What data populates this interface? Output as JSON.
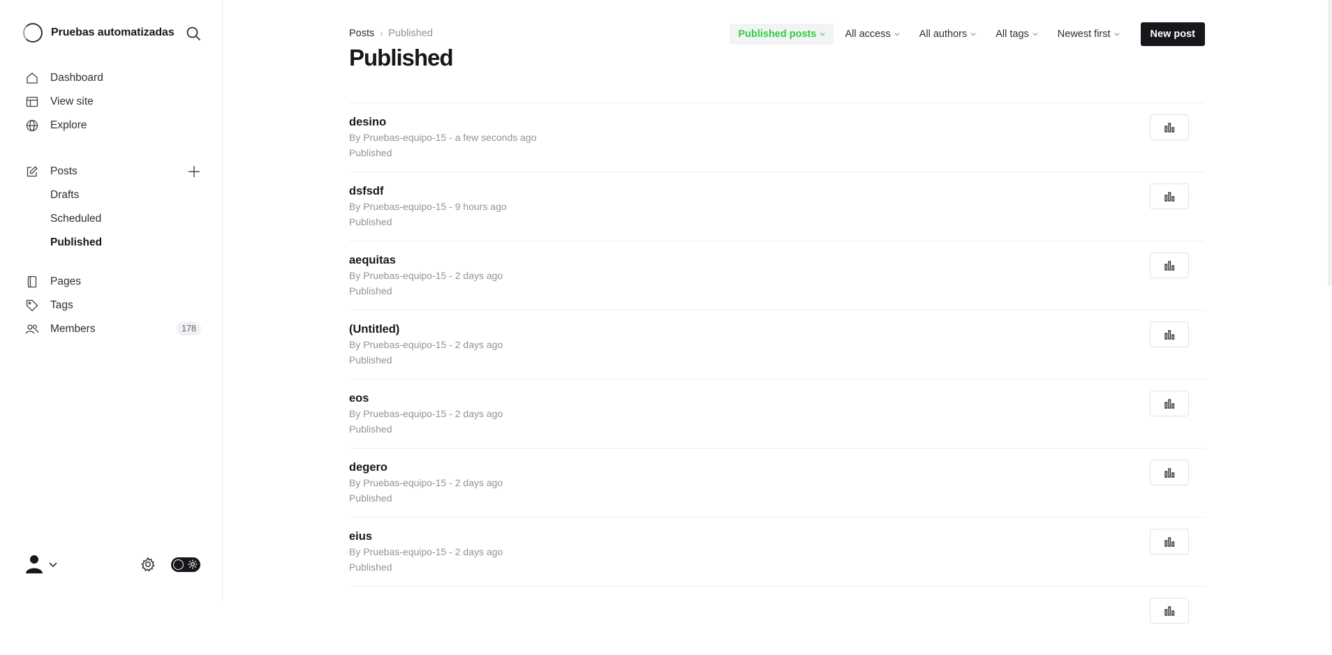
{
  "sidebar": {
    "site_name": "Pruebas automatizadas",
    "nav_primary": [
      {
        "label": "Dashboard",
        "icon": "home-icon"
      },
      {
        "label": "View site",
        "icon": "layout-icon"
      },
      {
        "label": "Explore",
        "icon": "globe-icon"
      }
    ],
    "posts": {
      "label": "Posts",
      "icon": "edit-icon"
    },
    "posts_sub": [
      {
        "label": "Drafts",
        "active": false
      },
      {
        "label": "Scheduled",
        "active": false
      },
      {
        "label": "Published",
        "active": true
      }
    ],
    "nav_secondary": [
      {
        "label": "Pages",
        "icon": "page-icon"
      },
      {
        "label": "Tags",
        "icon": "tag-icon"
      },
      {
        "label": "Members",
        "icon": "members-icon",
        "count": "178"
      }
    ]
  },
  "header": {
    "breadcrumb_parent": "Posts",
    "breadcrumb_current": "Published",
    "title": "Published",
    "filters": [
      {
        "label": "Published posts",
        "active": true
      },
      {
        "label": "All access",
        "active": false
      },
      {
        "label": "All authors",
        "active": false
      },
      {
        "label": "All tags",
        "active": false
      },
      {
        "label": "Newest first",
        "active": false
      }
    ],
    "new_post_label": "New post"
  },
  "posts": [
    {
      "title": "desino",
      "meta": "By Pruebas-equipo-15 - a few seconds ago",
      "status": "Published"
    },
    {
      "title": "dsfsdf",
      "meta": "By Pruebas-equipo-15 - 9 hours ago",
      "status": "Published"
    },
    {
      "title": "aequitas",
      "meta": "By Pruebas-equipo-15 - 2 days ago",
      "status": "Published"
    },
    {
      "title": "(Untitled)",
      "meta": "By Pruebas-equipo-15 - 2 days ago",
      "status": "Published"
    },
    {
      "title": "eos",
      "meta": "By Pruebas-equipo-15 - 2 days ago",
      "status": "Published"
    },
    {
      "title": "degero",
      "meta": "By Pruebas-equipo-15 - 2 days ago",
      "status": "Published"
    },
    {
      "title": "eius",
      "meta": "By Pruebas-equipo-15 - 2 days ago",
      "status": "Published"
    },
    {
      "title": "",
      "meta": "",
      "status": ""
    }
  ],
  "colors": {
    "accent_green": "#30cf43",
    "primary_dark": "#15171a"
  }
}
